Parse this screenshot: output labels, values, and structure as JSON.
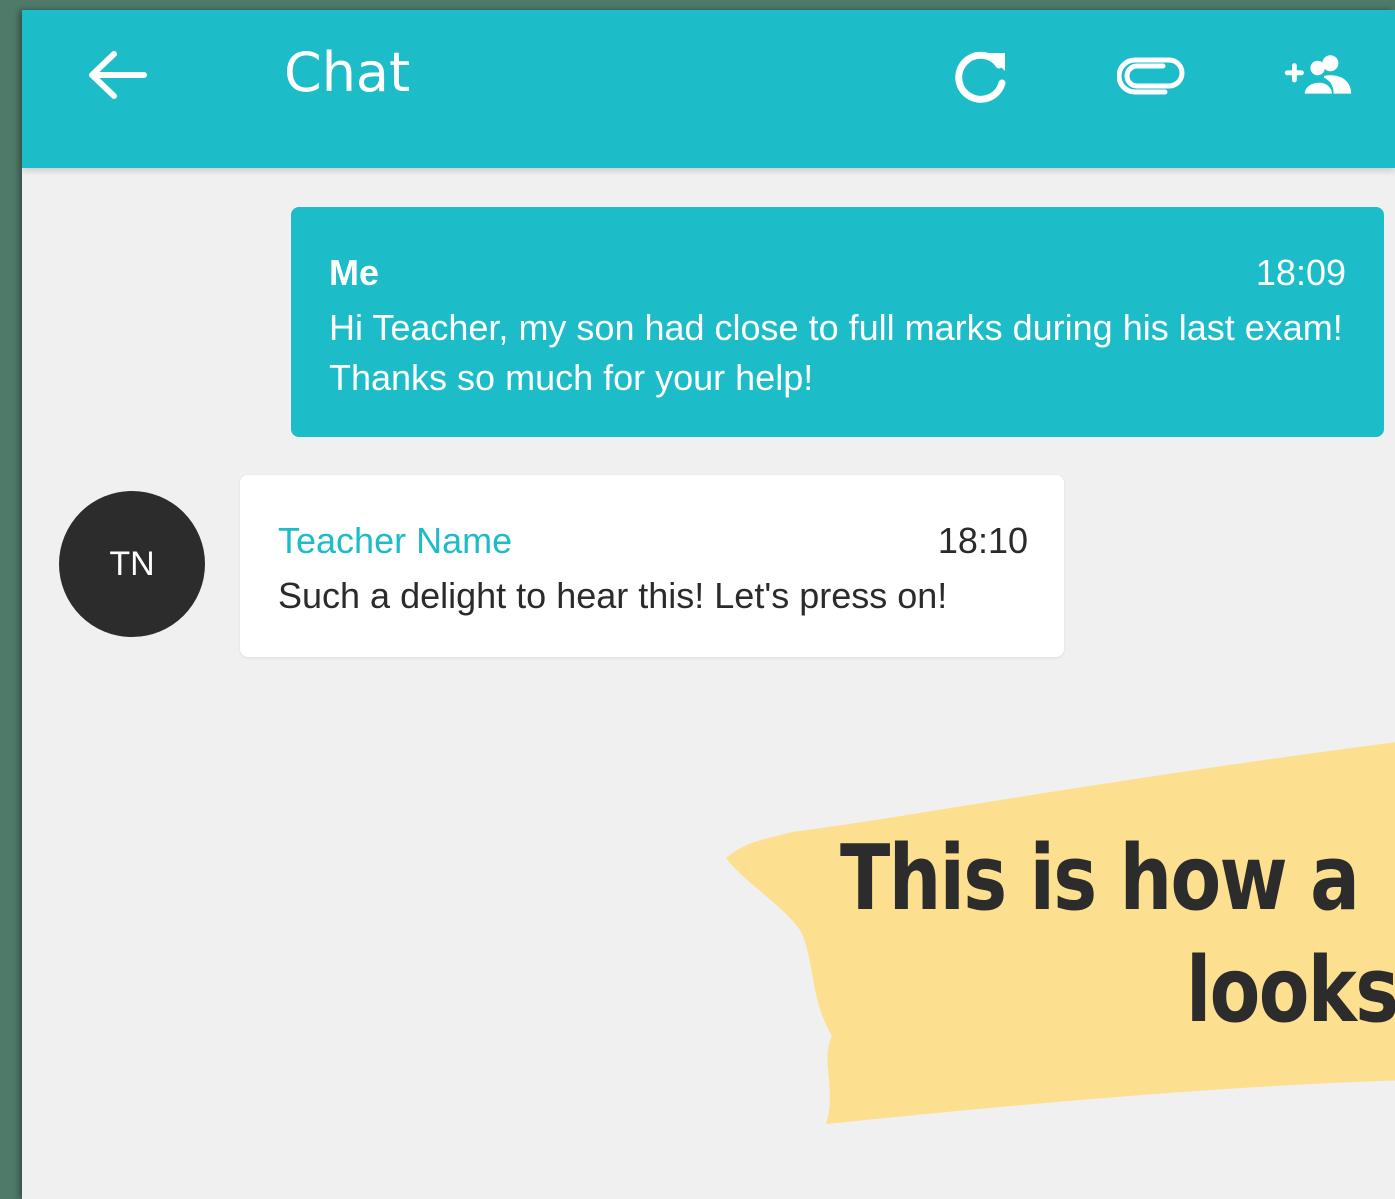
{
  "appbar": {
    "title": "Chat",
    "back_icon": "arrow-left-icon",
    "actions": [
      {
        "name": "refresh",
        "icon": "refresh-icon"
      },
      {
        "name": "attach",
        "icon": "paperclip-icon"
      },
      {
        "name": "add-participant",
        "icon": "add-people-icon"
      }
    ],
    "color": "#1cbcc9"
  },
  "messages": [
    {
      "sender": "Me",
      "time": "18:09",
      "text": "Hi Teacher, my son had close to full marks during his last exam! Thanks so much for your help!",
      "mine": true
    },
    {
      "sender": "Teacher Name",
      "time": "18:10",
      "text": "Such a delight to hear this! Let's press on!",
      "mine": false,
      "avatar_initials": "TN"
    }
  ],
  "banner": {
    "line1": "This is how a",
    "line2": "looks",
    "color": "#fde08f"
  }
}
